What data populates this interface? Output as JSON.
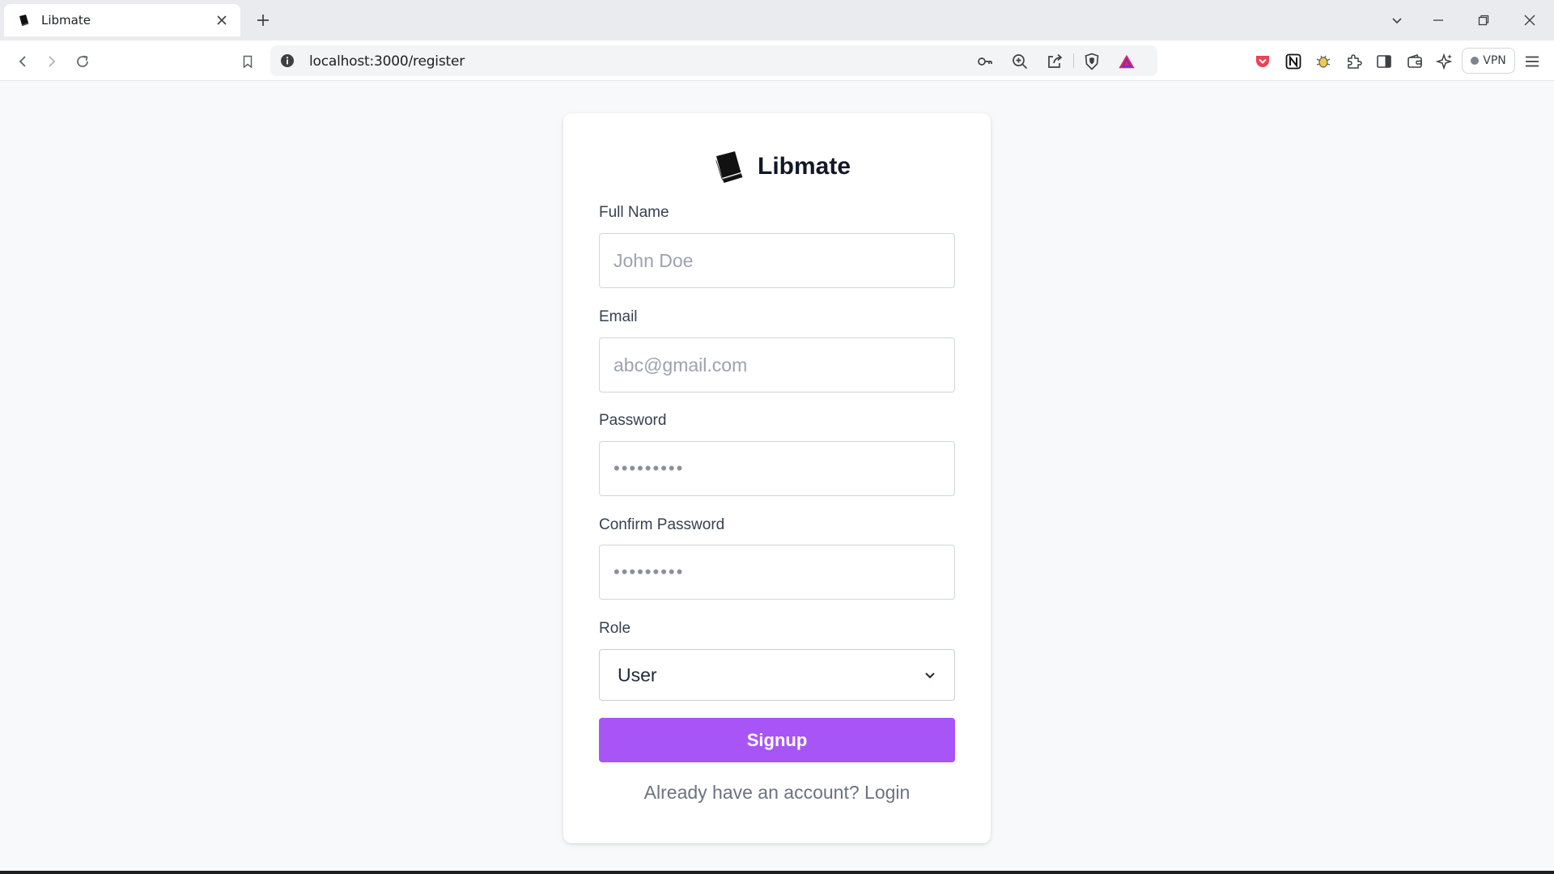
{
  "browser": {
    "tab_title": "Libmate",
    "url": "localhost:3000/register",
    "vpn_label": "VPN"
  },
  "brand": {
    "name": "Libmate",
    "accent_color": "#a855f7"
  },
  "form": {
    "full_name": {
      "label": "Full Name",
      "placeholder": "John Doe",
      "value": ""
    },
    "email": {
      "label": "Email",
      "placeholder": "abc@gmail.com",
      "value": ""
    },
    "password": {
      "label": "Password",
      "placeholder": "•••••••••",
      "value": ""
    },
    "confirm_password": {
      "label": "Confirm Password",
      "placeholder": "•••••••••",
      "value": ""
    },
    "role": {
      "label": "Role",
      "selected": "User"
    },
    "submit_label": "Signup",
    "login_prompt": "Already have an account?",
    "login_link": "Login"
  },
  "icons": {
    "tab_favicon": "libmate-book-icon",
    "tab_close": "close-icon",
    "new_tab": "plus-icon",
    "back": "back-arrow-icon",
    "forward": "forward-arrow-icon",
    "reload": "reload-icon",
    "bookmark": "bookmark-icon",
    "site_info": "info-icon",
    "password_key": "key-icon",
    "zoom": "zoom-icon",
    "share": "share-icon",
    "brave_shield": "brave-shield-icon",
    "brave_rewards": "brave-rewards-icon",
    "pocket": "pocket-icon",
    "notion": "notion-icon",
    "extension_bug": "bug-extension-icon",
    "extensions": "puzzle-icon",
    "sidebar": "sidebar-icon",
    "wallet": "wallet-icon",
    "leo_ai": "leo-ai-icon",
    "menu": "hamburger-menu-icon",
    "tab_search": "chevron-down-icon",
    "minimize": "minimize-icon",
    "restore": "restore-icon",
    "close_window": "close-window-icon",
    "role_chevron": "chevron-down-icon"
  }
}
